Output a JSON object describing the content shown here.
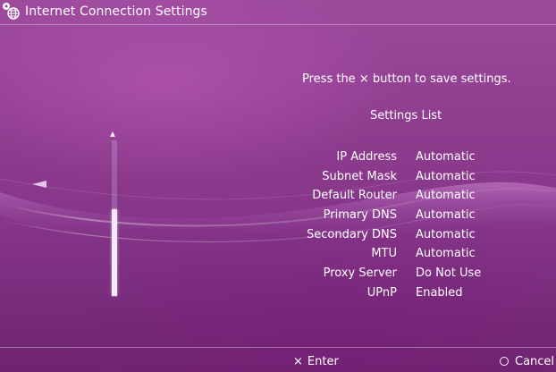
{
  "window": {
    "title": "Internet Connection Settings",
    "icon": "globe-network-icon"
  },
  "main": {
    "hint": {
      "before": "Press the",
      "glyph": "×",
      "after": "button to save settings."
    },
    "list_heading": "Settings List",
    "settings": [
      {
        "label": "IP Address",
        "value": "Automatic"
      },
      {
        "label": "Subnet Mask",
        "value": "Automatic"
      },
      {
        "label": "Default Router",
        "value": "Automatic"
      },
      {
        "label": "Primary DNS",
        "value": "Automatic"
      },
      {
        "label": "Secondary DNS",
        "value": "Automatic"
      },
      {
        "label": "MTU",
        "value": "Automatic"
      },
      {
        "label": "Proxy Server",
        "value": "Do Not Use"
      },
      {
        "label": "UPnP",
        "value": "Enabled"
      }
    ],
    "scroll_position": 0.55
  },
  "footer": {
    "enter": {
      "glyph": "×",
      "label": "Enter"
    },
    "cancel": {
      "glyph": "○",
      "label": "Cancel"
    }
  },
  "colors": {
    "background": "#8e3c8e",
    "text": "#ffffff",
    "arrow": "#e7c7ec"
  }
}
